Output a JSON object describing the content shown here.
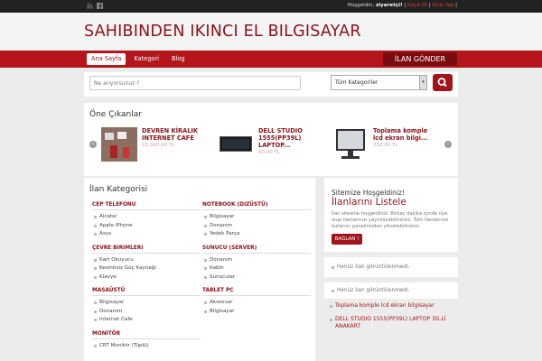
{
  "topbar": {
    "greeting": "Hoşgeldin,",
    "user": "ziyaretçi!",
    "sep1": "|",
    "register": "Kayıt Ol",
    "sep2": "|",
    "login": "Giriş Yap",
    "sep3": "|"
  },
  "site": {
    "title": "SAHIBINDEN IKINCI EL BILGISAYAR"
  },
  "nav": {
    "items": [
      {
        "label": "Ana Sayfa",
        "active": true
      },
      {
        "label": "Kategori",
        "active": false
      },
      {
        "label": "Blog",
        "active": false
      }
    ],
    "send_button": "İLAN GÖNDER"
  },
  "search": {
    "placeholder": "Ne arıyorsunuz ?",
    "category": "Tüm Kategoriler"
  },
  "featured": {
    "title": "Öne Çıkanlar",
    "items": [
      {
        "title": "DEVREN KİRALIK INTERNET CAFE",
        "price": "22.000,00 TL"
      },
      {
        "title": "DELL STUDIO 1555(PP39L) LAPTOP...",
        "price": "60,00 TL"
      },
      {
        "title": "Toplama komple lcd ekran bilgi...",
        "price": "350,00 TL"
      }
    ]
  },
  "categories": {
    "title": "İlan Kategorisi",
    "left": [
      {
        "heading": "CEP TELEFONU",
        "items": [
          "Alcatel",
          "Apple iPhone",
          "Asus"
        ]
      },
      {
        "heading": "ÇEVRE BIRIMLERI",
        "items": [
          "Kart Okuyucu",
          "Kesintisiz Güç Kaynağı",
          "Klavye"
        ]
      },
      {
        "heading": "MASAÜSTÜ",
        "items": [
          "Bilgisayar",
          "Donanım",
          "Internet Cafe"
        ]
      },
      {
        "heading": "MONITÖR",
        "items": [
          "CRT Monitör (Tüplü)"
        ]
      }
    ],
    "right": [
      {
        "heading": "NOTEBOOK (DIZÜSTÜ)",
        "items": [
          "Bilgisayar",
          "Donanım",
          "Yedek Parça"
        ]
      },
      {
        "heading": "SUNUCU (SERVER)",
        "items": [
          "Donanım",
          "Kabin",
          "Sunucular"
        ]
      },
      {
        "heading": "TABLET PC",
        "items": [
          "Aksesuar",
          "Bilgisayar"
        ]
      }
    ]
  },
  "sidebar": {
    "welcome_line": "Sitemize Hoşgeldiniz!",
    "welcome_title": "İlanlarını Listele",
    "welcome_text": "İlan sitesine hoşgeldiniz. Birkaç dakika içinde üye olup ilanlarınızı yayınlayabilirsiniz. Tüm İlanlarınızı kullanıcı panelinizden yönetebilirsiniz.",
    "connect_button": "BAĞLAN !",
    "empty1": "Henüz ilan görüntülenmedi.",
    "empty2": "Henüz ilan görüntülenmedi.",
    "links": [
      "Toplama komple lcd ekran bilgisayar",
      "DELL STUDIO 1555(PP39L) LAPTOP 3G.Lİ ANAKART"
    ]
  },
  "colors": {
    "accent": "#b5161c",
    "dark_accent": "#8b1218",
    "topbar": "#222222"
  }
}
